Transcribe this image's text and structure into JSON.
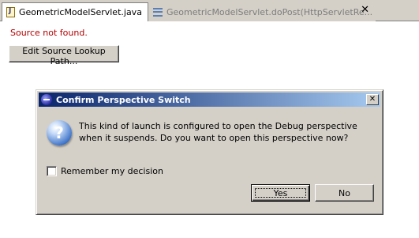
{
  "editor": {
    "tabs": [
      {
        "label": "GeometricModelServlet.java",
        "icon": "java-file-icon",
        "active": true
      },
      {
        "label": "GeometricModelServlet.doPost(HttpServletRe...",
        "icon": "method-icon",
        "active": false
      }
    ],
    "tab_close_label": "✕",
    "source_message": "Source not found.",
    "edit_lookup_label": "Edit Source Lookup Path..."
  },
  "dialog": {
    "title": "Confirm Perspective Switch",
    "close_label": "✕",
    "icon": "question-icon",
    "icon_glyph": "?",
    "message": "This kind of launch is configured to open the Debug perspective when it suspends. Do you want to open this perspective now?",
    "remember_label": "Remember my decision",
    "remember_checked": false,
    "yes_label": "Yes",
    "no_label": "No"
  },
  "colors": {
    "title_gradient_start": "#0a246a",
    "title_gradient_end": "#a6caf0",
    "error_text": "#b00000",
    "dialog_background": "#d4d0c8"
  }
}
